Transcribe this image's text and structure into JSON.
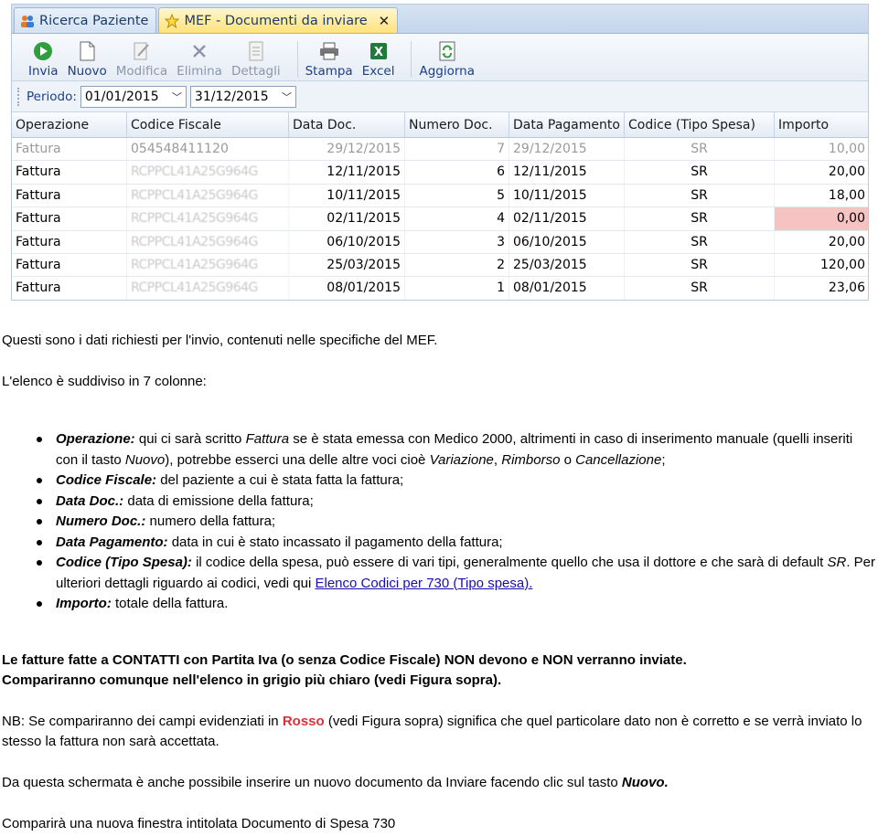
{
  "app": {
    "tabs": [
      {
        "label": "Ricerca Paziente",
        "icon": "people-icon",
        "active": false
      },
      {
        "label": "MEF - Documenti da inviare",
        "icon": "star-icon",
        "active": true
      }
    ],
    "toolbar": {
      "invia": "Invia",
      "nuovo": "Nuovo",
      "modifica": "Modifica",
      "elimina": "Elimina",
      "dettagli": "Dettagli",
      "stampa": "Stampa",
      "excel": "Excel",
      "aggiorna": "Aggiorna"
    },
    "period": {
      "label": "Periodo:",
      "from": "01/01/2015",
      "to": "31/12/2015"
    },
    "grid": {
      "columns": [
        "Operazione",
        "Codice Fiscale",
        "Data Doc.",
        "Numero Doc.",
        "Data Pagamento",
        "Codice (Tipo Spesa)",
        "Importo"
      ],
      "rows": [
        {
          "op": "Fattura",
          "cf": "054548411120",
          "data_doc": "29/12/2015",
          "num": "7",
          "data_pag": "29/12/2015",
          "tipo": "SR",
          "importo": "10,00",
          "gray": true,
          "error": false
        },
        {
          "op": "Fattura",
          "cf": "RCPPCL41A25G964G",
          "data_doc": "12/11/2015",
          "num": "6",
          "data_pag": "12/11/2015",
          "tipo": "SR",
          "importo": "20,00",
          "gray": false,
          "error": false
        },
        {
          "op": "Fattura",
          "cf": "RCPPCL41A25G964G",
          "data_doc": "10/11/2015",
          "num": "5",
          "data_pag": "10/11/2015",
          "tipo": "SR",
          "importo": "18,00",
          "gray": false,
          "error": false
        },
        {
          "op": "Fattura",
          "cf": "RCPPCL41A25G964G",
          "data_doc": "02/11/2015",
          "num": "4",
          "data_pag": "02/11/2015",
          "tipo": "SR",
          "importo": "0,00",
          "gray": false,
          "error": true
        },
        {
          "op": "Fattura",
          "cf": "RCPPCL41A25G964G",
          "data_doc": "06/10/2015",
          "num": "3",
          "data_pag": "06/10/2015",
          "tipo": "SR",
          "importo": "20,00",
          "gray": false,
          "error": false
        },
        {
          "op": "Fattura",
          "cf": "RCPPCL41A25G964G",
          "data_doc": "25/03/2015",
          "num": "2",
          "data_pag": "25/03/2015",
          "tipo": "SR",
          "importo": "120,00",
          "gray": false,
          "error": false
        },
        {
          "op": "Fattura",
          "cf": "RCPPCL41A25G964G",
          "data_doc": "08/01/2015",
          "num": "1",
          "data_pag": "08/01/2015",
          "tipo": "SR",
          "importo": "23,06",
          "gray": false,
          "error": false
        }
      ],
      "error_color": "#f7c2c2"
    }
  },
  "doc": {
    "p1": "Questi sono i dati richiesti per l'invio, contenuti nelle specifiche del MEF.",
    "p2": "L'elenco è suddiviso in 7 colonne:",
    "b1": {
      "term": "Operazione:",
      "t1": " qui ci sarà scritto ",
      "i1": "Fattura",
      "t2": " se è stata emessa con Medico 2000, altrimenti in caso di inserimento manuale (quelli inseriti con il tasto ",
      "i2": "Nuovo",
      "t3": "), potrebbe esserci una delle altre voci cioè ",
      "i3": "Variazione",
      "t4": ", ",
      "i4": "Rimborso",
      "t5": " o ",
      "i5": "Cancellazione",
      "t6": ";"
    },
    "b2": {
      "term": "Codice Fiscale:",
      "text": " del paziente a cui è stata fatta la fattura;"
    },
    "b3": {
      "term": "Data Doc.:",
      "text": " data di emissione della fattura;"
    },
    "b4": {
      "term": "Numero Doc.:",
      "text": " numero della fattura;"
    },
    "b5": {
      "term": "Data Pagamento:",
      "text": " data in cui è stato incassato il pagamento della fattura;"
    },
    "b6": {
      "term": "Codice (Tipo Spesa):",
      "t1": " il codice della spesa, può essere di vari tipi, generalmente quello che usa il dottore e che sarà di default ",
      "i1": "SR",
      "t2": ". Per ulteriori dettagli riguardo ai codici, vedi qui ",
      "link": "Elenco Codici per 730 (Tipo spesa)."
    },
    "b7": {
      "term": "Importo:",
      "text": " totale della fattura."
    },
    "bold_line1": "Le fatture fatte a CONTATTI con Partita Iva (o senza Codice Fiscale) NON devono e NON verranno inviate.",
    "bold_line2": "Compariranno comunque nell'elenco in grigio più chiaro (vedi Figura sopra).",
    "nb": {
      "t1": "NB: Se compariranno dei campi evidenziati in ",
      "red": "Rosso",
      "t2": " (vedi Figura sopra) significa che quel particolare dato non è corretto e se verrà inviato lo stesso la fattura non sarà accettata."
    },
    "p_nuovo": {
      "t1": "Da questa schermata è anche possibile inserire un nuovo documento da Inviare facendo clic sul tasto ",
      "bi": "Nuovo."
    },
    "p_last": "Comparirà una nuova finestra intitolata Documento di Spesa 730",
    "red_color": "#d9303e"
  }
}
